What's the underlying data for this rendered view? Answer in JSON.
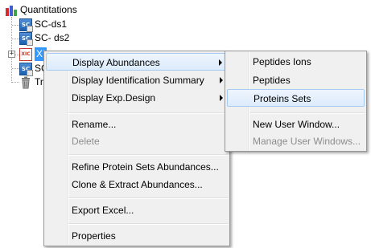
{
  "tree": {
    "root_label": "Quantitations",
    "items": [
      {
        "label": "SC-ds1",
        "icon": "spectral-count-icon"
      },
      {
        "label": "SC- ds2",
        "icon": "spectral-count-icon"
      },
      {
        "label": "XI",
        "icon": "xic-icon",
        "selected": true
      },
      {
        "label": "SC",
        "icon": "spectral-count-icon"
      },
      {
        "label": "Tr",
        "icon": "trash-icon"
      }
    ],
    "xic_icon_text": "XIC",
    "sc_icon_text": "SC"
  },
  "context_menu": {
    "items": [
      {
        "label": "Display Abundances",
        "submenu": true,
        "highlighted": true
      },
      {
        "label": "Display Identification Summary",
        "submenu": true
      },
      {
        "label": "Display Exp.Design",
        "submenu": true
      },
      {
        "label": "Rename..."
      },
      {
        "label": "Delete",
        "disabled": true
      },
      {
        "label": "Refine Protein Sets Abundances..."
      },
      {
        "label": "Clone & Extract Abundances..."
      },
      {
        "label": "Export Excel..."
      },
      {
        "label": "Properties"
      }
    ]
  },
  "submenu": {
    "items": [
      {
        "label": "Peptides Ions"
      },
      {
        "label": "Peptides"
      },
      {
        "label": "Proteins Sets",
        "highlighted": true
      },
      {
        "label": "New User Window..."
      },
      {
        "label": "Manage User Windows...",
        "disabled": true
      }
    ]
  },
  "colors": {
    "selection": "#3399ff",
    "menu_background": "#f0f0f0",
    "hover_border": "#a8cbf1"
  }
}
